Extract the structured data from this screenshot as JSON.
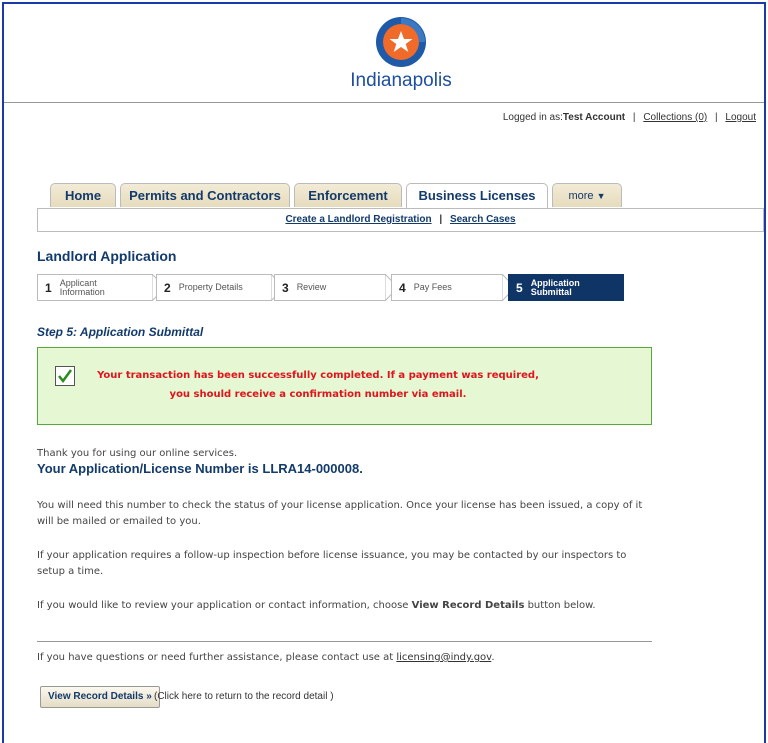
{
  "brand": {
    "name": "Indianapolis",
    "colors": {
      "blue": "#1e4f9e",
      "orange": "#f06a2a",
      "navy": "#123a6b"
    }
  },
  "userbar": {
    "prefix": "Logged in as:",
    "user": "Test Account",
    "collections": "Collections (0)",
    "logout": "Logout"
  },
  "tabs": [
    {
      "label": "Home"
    },
    {
      "label": "Permits and Contractors"
    },
    {
      "label": "Enforcement"
    },
    {
      "label": "Business Licenses",
      "active": true
    },
    {
      "label": "more"
    }
  ],
  "subnav": {
    "link1": "Create a Landlord Registration",
    "link2": "Search Cases"
  },
  "page": {
    "title": "Landlord Application"
  },
  "steps": [
    {
      "num": "1",
      "label_line1": "Applicant",
      "label_line2": "Information"
    },
    {
      "num": "2",
      "label_line1": "Property Details",
      "label_line2": ""
    },
    {
      "num": "3",
      "label_line1": "Review",
      "label_line2": ""
    },
    {
      "num": "4",
      "label_line1": "Pay Fees",
      "label_line2": ""
    },
    {
      "num": "5",
      "label_line1": "Application",
      "label_line2": "Submittal",
      "active": true
    }
  ],
  "step_heading": "Step 5: Application Submittal",
  "notice": {
    "line1": "Your transaction has been successfully completed. If a payment was required,",
    "line2": "you should receive a confirmation number via email."
  },
  "content": {
    "thanks": "Thank you for using our online services.",
    "license_number": "Your Application/License Number is LLRA14-000008.",
    "para1": "You will need this number to check the status of your license application. Once your license has been issued, a copy of it will be mailed or emailed to you.",
    "para2": "If your application requires a follow-up inspection before license issuance, you may be contacted by our inspectors to setup a time.",
    "para3_prefix": "If you would like to review your application or contact information, choose ",
    "para3_bold": "View Record Details",
    "para3_suffix": " button below.",
    "help_prefix": "If you have questions or need further assistance, please contact use at ",
    "help_email": "licensing@indy.gov",
    "help_suffix": "."
  },
  "actions": {
    "view_button": "View Record Details »",
    "view_hint": "(Click here to return to the record detail )"
  }
}
